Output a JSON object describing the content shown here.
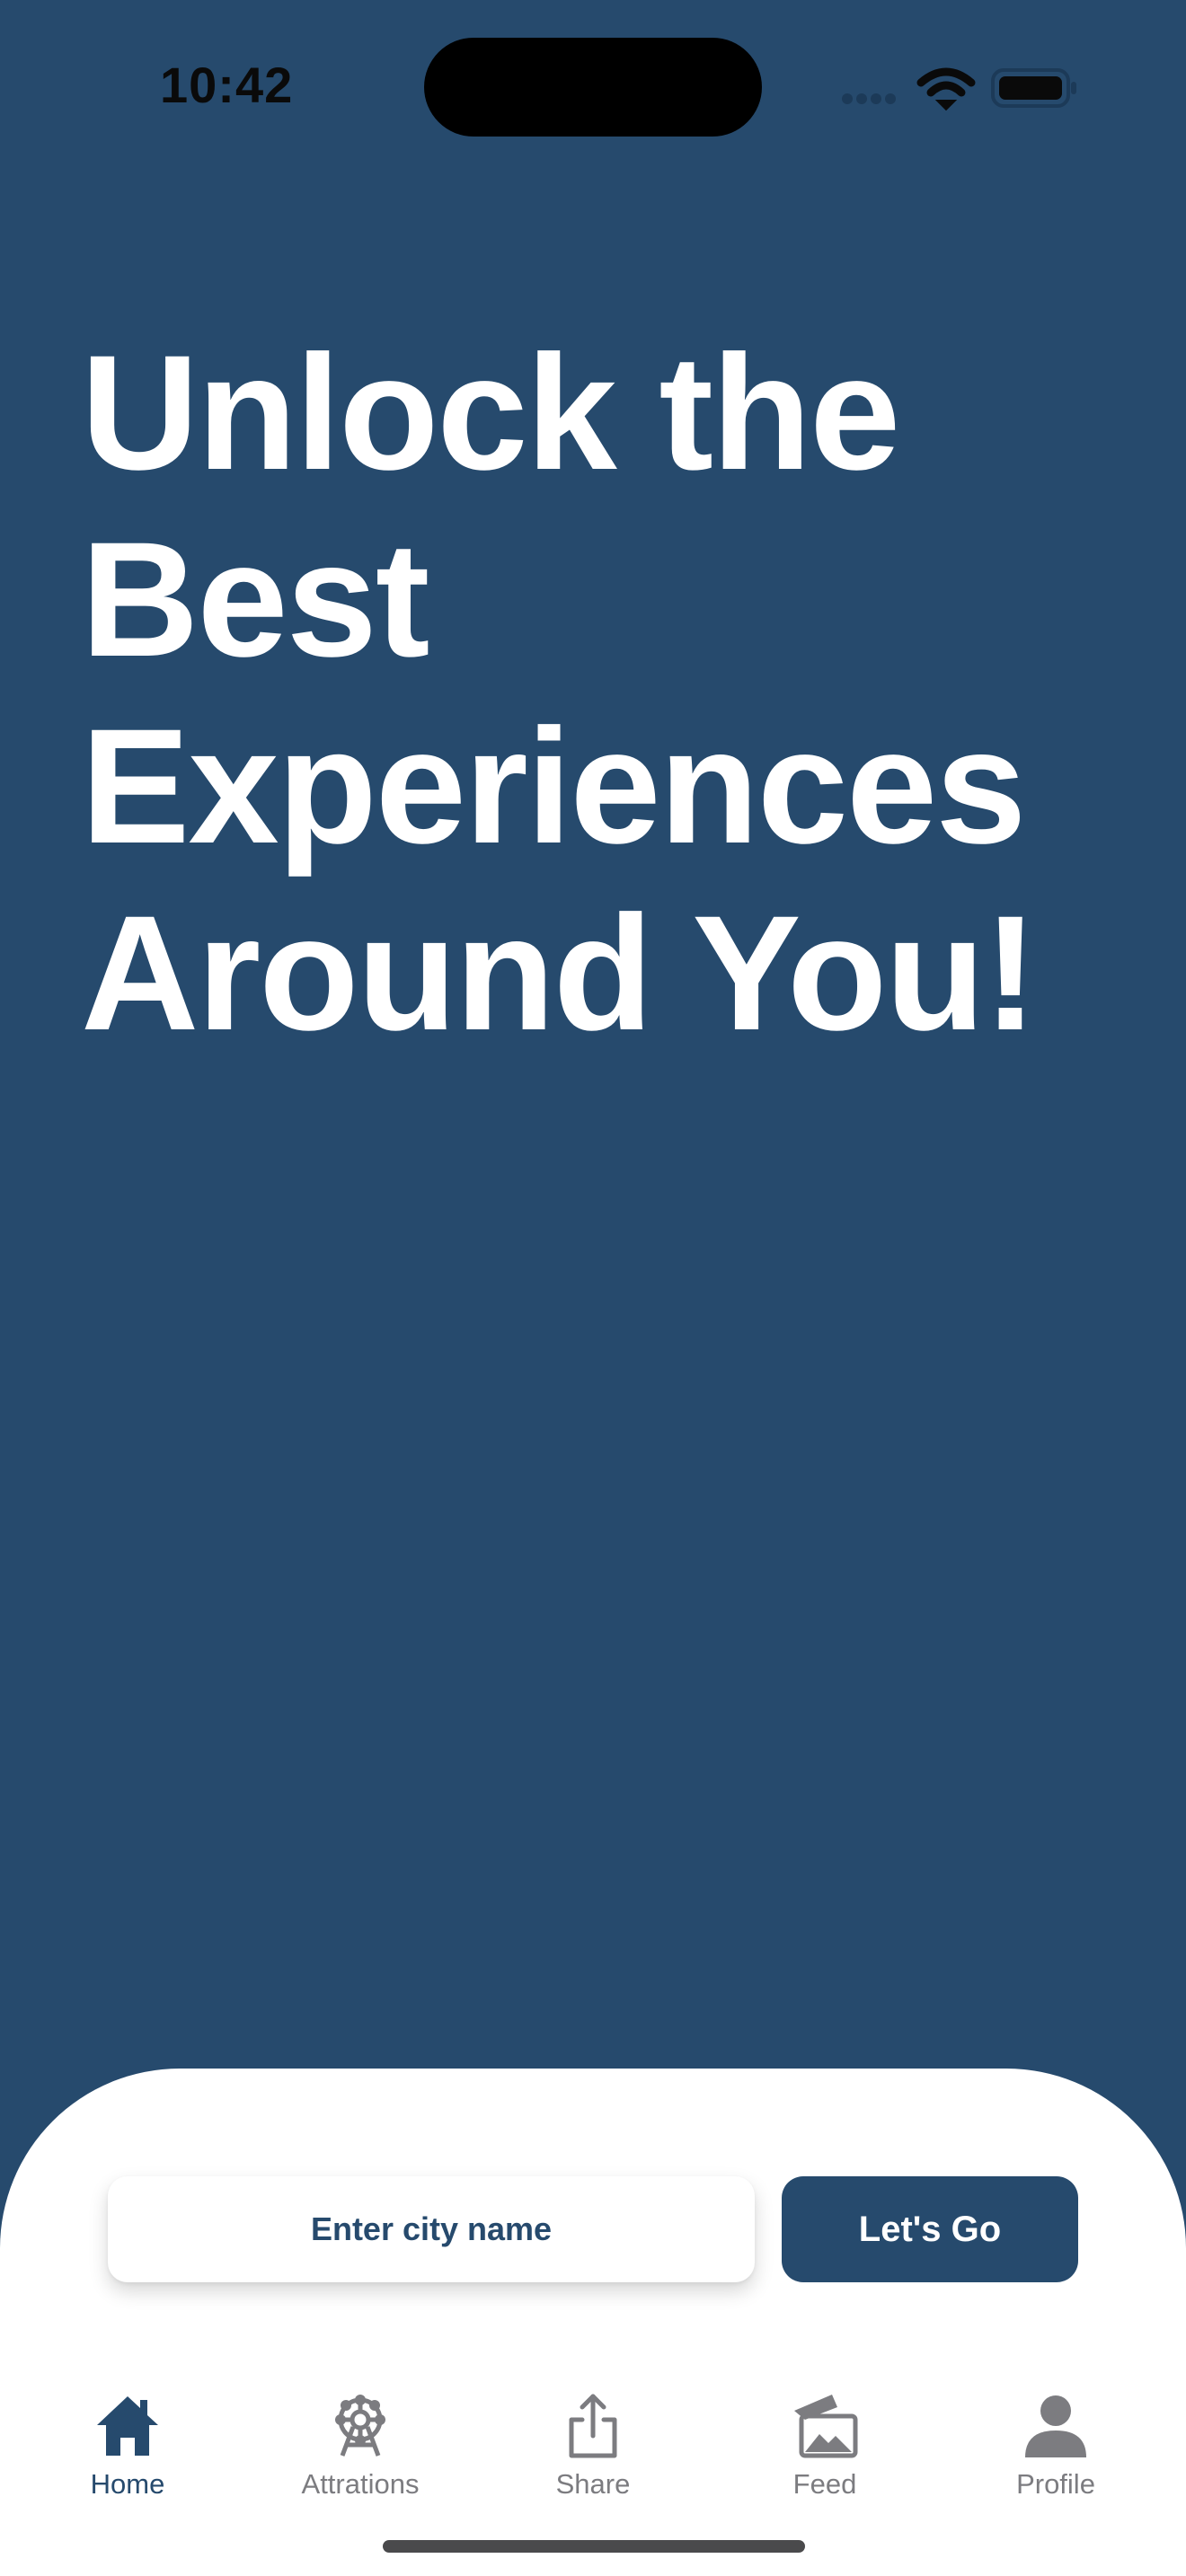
{
  "status_bar": {
    "time": "10:42"
  },
  "hero": {
    "line1": "Unlock the",
    "line2": "Best",
    "line3": "Experiences",
    "line4": "Around You!"
  },
  "search": {
    "placeholder": "Enter city name",
    "value": "",
    "button_label": "Let's Go"
  },
  "tab_bar": {
    "active": "Home",
    "tabs": [
      {
        "label": "Home",
        "icon": "home-icon"
      },
      {
        "label": "Attrations",
        "icon": "ferris-wheel-icon"
      },
      {
        "label": "Share",
        "icon": "share-icon"
      },
      {
        "label": "Feed",
        "icon": "photos-icon"
      },
      {
        "label": "Profile",
        "icon": "person-icon"
      }
    ]
  },
  "colors": {
    "brand": "#264a6d",
    "sheet": "#ffffff",
    "tab_inactive": "#7c7c80",
    "status_text": "#0a0a0a"
  }
}
